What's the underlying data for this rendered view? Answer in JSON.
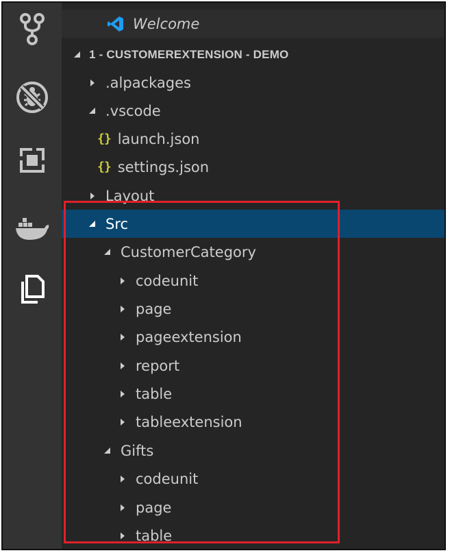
{
  "activity_bar": {
    "icons": [
      "source-control-icon",
      "debug-icon",
      "extensions-icon",
      "docker-icon",
      "explorer-icon"
    ]
  },
  "explorer": {
    "open_editor": "Welcome",
    "root": "1 - CUSTOMEREXTENSION - DEMO",
    "items": [
      {
        "label": ".alpackages",
        "expanded": false,
        "type": "folder"
      },
      {
        "label": ".vscode",
        "expanded": true,
        "type": "folder"
      },
      {
        "label": "launch.json",
        "type": "json"
      },
      {
        "label": "settings.json",
        "type": "json"
      },
      {
        "label": "Layout",
        "expanded": false,
        "type": "folder"
      },
      {
        "label": "Src",
        "expanded": true,
        "type": "folder",
        "selected": true
      },
      {
        "label": "CustomerCategory",
        "expanded": true,
        "type": "folder"
      },
      {
        "label": "codeunit",
        "expanded": false,
        "type": "folder"
      },
      {
        "label": "page",
        "expanded": false,
        "type": "folder"
      },
      {
        "label": "pageextension",
        "expanded": false,
        "type": "folder"
      },
      {
        "label": "report",
        "expanded": false,
        "type": "folder"
      },
      {
        "label": "table",
        "expanded": false,
        "type": "folder"
      },
      {
        "label": "tableextension",
        "expanded": false,
        "type": "folder"
      },
      {
        "label": "Gifts",
        "expanded": true,
        "type": "folder"
      },
      {
        "label": "codeunit",
        "expanded": false,
        "type": "folder"
      },
      {
        "label": "page",
        "expanded": false,
        "type": "folder"
      },
      {
        "label": "table",
        "expanded": false,
        "type": "folder"
      }
    ]
  },
  "json_icon_glyph": "{}",
  "colors": {
    "selection": "#094771",
    "highlight": "#e0202a",
    "json_icon": "#cbcb41"
  }
}
